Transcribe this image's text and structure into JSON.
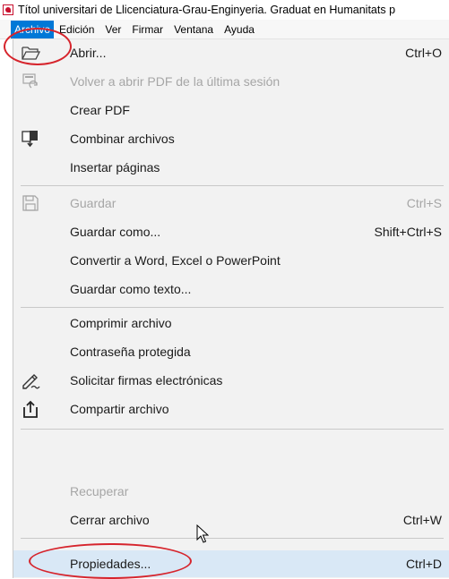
{
  "window": {
    "title": "Títol universitari de Llicenciatura-Grau-Enginyeria. Graduat en Humanitats p"
  },
  "menubar": {
    "items": [
      {
        "label": "Archivo",
        "active": true
      },
      {
        "label": "Edición"
      },
      {
        "label": "Ver"
      },
      {
        "label": "Firmar"
      },
      {
        "label": "Ventana"
      },
      {
        "label": "Ayuda"
      }
    ]
  },
  "file_menu": {
    "open": {
      "label": "Abrir...",
      "shortcut": "Ctrl+O",
      "icon": "folder-open-icon"
    },
    "reopen": {
      "label": "Volver a abrir PDF de la última sesión",
      "icon": "reopen-pdf-icon",
      "disabled": true
    },
    "create_pdf": {
      "label": "Crear PDF"
    },
    "combine": {
      "label": "Combinar archivos",
      "icon": "combine-files-icon"
    },
    "insert_pages": {
      "label": "Insertar páginas"
    },
    "save": {
      "label": "Guardar",
      "shortcut": "Ctrl+S",
      "icon": "save-icon",
      "disabled": true
    },
    "save_as": {
      "label": "Guardar como...",
      "shortcut": "Shift+Ctrl+S"
    },
    "convert": {
      "label": "Convertir a Word, Excel o PowerPoint"
    },
    "save_text": {
      "label": "Guardar como texto..."
    },
    "compress": {
      "label": "Comprimir archivo"
    },
    "password": {
      "label": "Contraseña protegida"
    },
    "signatures": {
      "label": "Solicitar firmas electrónicas",
      "icon": "signature-pen-icon"
    },
    "share": {
      "label": "Compartir archivo",
      "icon": "share-upload-icon"
    },
    "recover": {
      "label": "Recuperar",
      "disabled": true
    },
    "close": {
      "label": "Cerrar archivo",
      "shortcut": "Ctrl+W"
    },
    "properties": {
      "label": "Propiedades...",
      "shortcut": "Ctrl+D",
      "highlighted": true
    }
  },
  "colors": {
    "accent": "#0078d7",
    "highlight": "#d9e8f6",
    "annotation": "#d6242c",
    "menu_bg": "#f2f2f2",
    "disabled_text": "#a6a6a6"
  }
}
